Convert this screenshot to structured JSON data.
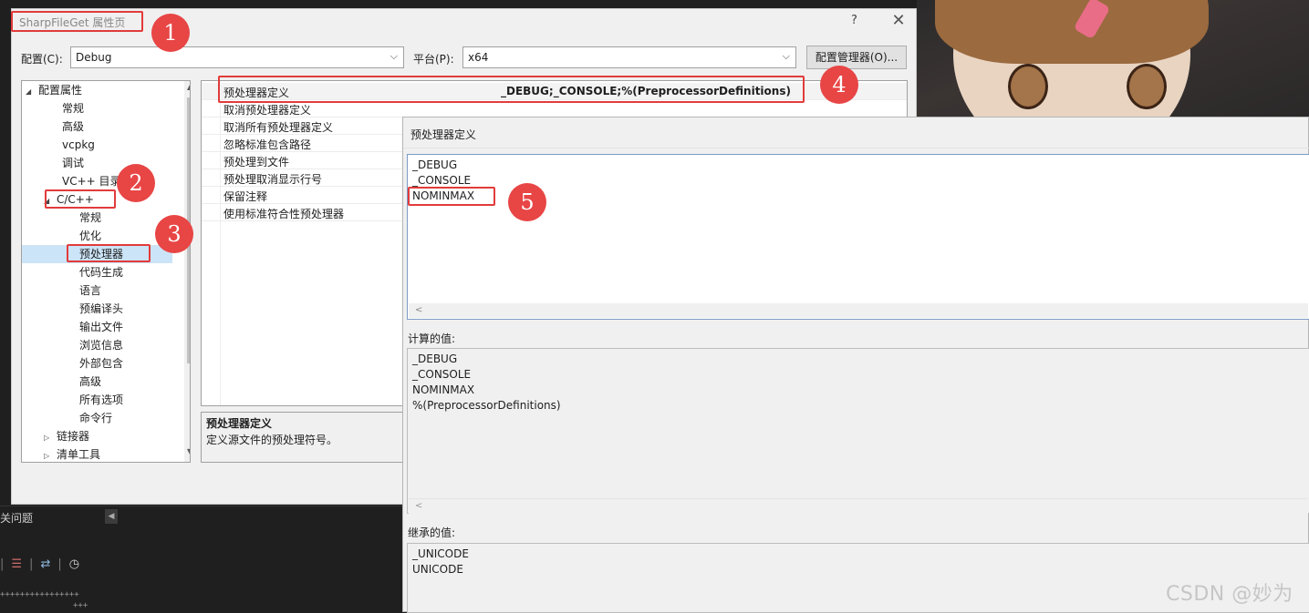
{
  "background": {
    "problems_label": "关问题",
    "toolbar_icons": [
      "delete-list-icon",
      "swap-icon",
      "clock-icon"
    ],
    "plus_line1": "++++++++++++++++",
    "plus_line2": "+++"
  },
  "dialog": {
    "title": "SharpFileGet 属性页",
    "help": "?",
    "close": "✕",
    "config_label": "配置(C):",
    "config_value": "Debug",
    "platform_label": "平台(P):",
    "platform_value": "x64",
    "config_manager_button": "配置管理器(O)..."
  },
  "tree": {
    "items": [
      {
        "label": "配置属性",
        "expanded": true
      },
      {
        "label": "常规"
      },
      {
        "label": "高级"
      },
      {
        "label": "vcpkg"
      },
      {
        "label": "调试"
      },
      {
        "label": "VC++ 目录"
      },
      {
        "label": "C/C++",
        "expanded": true
      },
      {
        "label": "常规"
      },
      {
        "label": "优化"
      },
      {
        "label": "预处理器",
        "selected": true
      },
      {
        "label": "代码生成"
      },
      {
        "label": "语言"
      },
      {
        "label": "预编译头"
      },
      {
        "label": "输出文件"
      },
      {
        "label": "浏览信息"
      },
      {
        "label": "外部包含"
      },
      {
        "label": "高级"
      },
      {
        "label": "所有选项"
      },
      {
        "label": "命令行"
      },
      {
        "label": "链接器",
        "expanded": false
      },
      {
        "label": "清单工具",
        "expanded": false
      }
    ]
  },
  "grid": {
    "rows": [
      {
        "name": "预处理器定义",
        "value": "_DEBUG;_CONSOLE;%(PreprocessorDefinitions)"
      },
      {
        "name": "取消预处理器定义",
        "value": ""
      },
      {
        "name": "取消所有预处理器定义",
        "value": ""
      },
      {
        "name": "忽略标准包含路径",
        "value": ""
      },
      {
        "name": "预处理到文件",
        "value": ""
      },
      {
        "name": "预处理取消显示行号",
        "value": ""
      },
      {
        "name": "保留注释",
        "value": ""
      },
      {
        "name": "使用标准符合性预处理器",
        "value": ""
      }
    ]
  },
  "description": {
    "title": "预处理器定义",
    "text": "定义源文件的预处理符号。"
  },
  "sub_dialog": {
    "title": "预处理器定义",
    "edit_lines": [
      "_DEBUG",
      "_CONSOLE",
      "NOMINMAX"
    ],
    "computed_label": "计算的值:",
    "computed_lines": [
      "_DEBUG",
      "_CONSOLE",
      "NOMINMAX",
      "%(PreprocessorDefinitions)"
    ],
    "inherited_label": "继承的值:",
    "inherited_lines": [
      "_UNICODE",
      "UNICODE"
    ],
    "scroll_left": "<"
  },
  "annotations": [
    "1",
    "2",
    "3",
    "4",
    "5"
  ],
  "watermark": "CSDN @妙为",
  "colors": {
    "annotation_red": "#e23b3b",
    "badge_red": "#e84545",
    "selected_row": "#cce4f7",
    "dark_bg": "#1f1f1f"
  }
}
